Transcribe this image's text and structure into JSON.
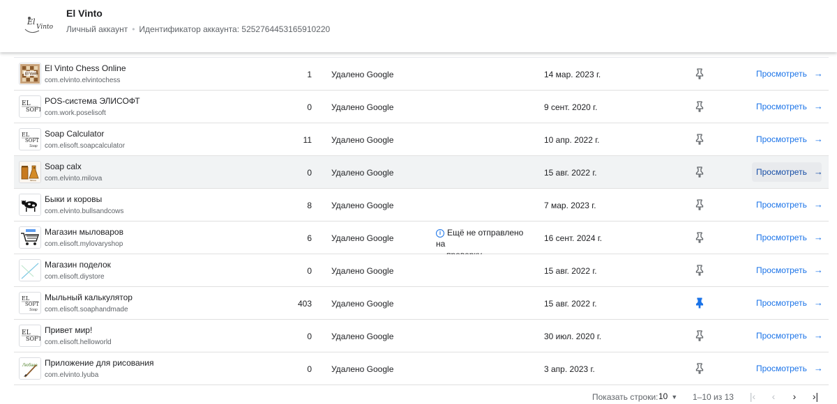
{
  "header": {
    "developer_name": "El Vinto",
    "account_type": "Личный аккаунт",
    "account_id_label": "Идентификатор аккаунта: 5252764453165910220"
  },
  "apps": [
    {
      "name": "El Vinto Chess Online",
      "package": "com.elvinto.elvintochess",
      "installs": "1",
      "status": "Удалено Google",
      "update": "",
      "date": "14 мар. 2023 г.",
      "pinned": false,
      "view": "Просмотреть",
      "icon": "chess-board-icon"
    },
    {
      "name": "POS-система ЭЛИСОФТ",
      "package": "com.work.poselisoft",
      "installs": "0",
      "status": "Удалено Google",
      "update": "",
      "date": "9 сент. 2020 г.",
      "pinned": false,
      "view": "Просмотреть",
      "icon": "elisoft-logo-icon"
    },
    {
      "name": "Soap Calculator",
      "package": "com.elisoft.soapcalculator",
      "installs": "11",
      "status": "Удалено Google",
      "update": "",
      "date": "10 апр. 2022 г.",
      "pinned": false,
      "view": "Просмотреть",
      "icon": "elisoft-soap-icon"
    },
    {
      "name": "Soap calx",
      "package": "com.elvinto.milova",
      "installs": "0",
      "status": "Удалено Google",
      "update": "",
      "date": "15 авг. 2022 г.",
      "pinned": false,
      "view": "Просмотреть",
      "icon": "flask-icon"
    },
    {
      "name": "Быки и коровы",
      "package": "com.elvinto.bullsandcows",
      "installs": "8",
      "status": "Удалено Google",
      "update": "",
      "date": "7 мар. 2023 г.",
      "pinned": false,
      "view": "Просмотреть",
      "icon": "cow-icon"
    },
    {
      "name": "Магазин мыловаров",
      "package": "com.elisoft.mylovaryshop",
      "installs": "6",
      "status": "Удалено Google",
      "update_line1": "Ещё не отправлено на",
      "update_line2": "проверку",
      "date": "16 сент. 2024 г.",
      "pinned": false,
      "view": "Просмотреть",
      "icon": "shopping-cart-icon"
    },
    {
      "name": "Магазин поделок",
      "package": "com.elisoft.diystore",
      "installs": "0",
      "status": "Удалено Google",
      "update": "",
      "date": "15 авг. 2022 г.",
      "pinned": false,
      "view": "Просмотреть",
      "icon": "diagonal-placeholder-icon"
    },
    {
      "name": "Мыльный калькулятор",
      "package": "com.elisoft.soaphandmade",
      "installs": "403",
      "status": "Удалено Google",
      "update": "",
      "date": "15 авг. 2022 г.",
      "pinned": true,
      "view": "Просмотреть",
      "icon": "elisoft-soap-icon"
    },
    {
      "name": "Привет мир!",
      "package": "com.elisoft.helloworld",
      "installs": "0",
      "status": "Удалено Google",
      "update": "",
      "date": "30 июл. 2020 г.",
      "pinned": false,
      "view": "Просмотреть",
      "icon": "elisoft-logo-icon"
    },
    {
      "name": "Приложение для рисования",
      "package": "com.elvinto.lyuba",
      "installs": "0",
      "status": "Удалено Google",
      "update": "",
      "date": "3 апр. 2023 г.",
      "pinned": false,
      "view": "Просмотреть",
      "icon": "paintbrush-icon"
    }
  ],
  "footer": {
    "rows_label": "Показать строки:",
    "rows_value": "10",
    "range": "1–10 из 13"
  },
  "colors": {
    "accent": "#1a73e8",
    "pinned": "#1a73e8",
    "unpinned": "#5f6368"
  }
}
